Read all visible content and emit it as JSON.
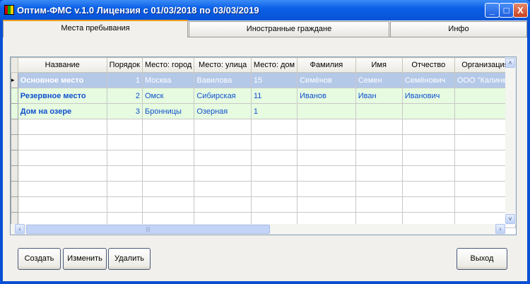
{
  "window": {
    "title": "Оптим-ФМС v.1.0  Лицензия с 01/03/2018 по 03/03/2019",
    "minimize": "_",
    "maximize": "□",
    "close": "X"
  },
  "tabs": [
    {
      "label": "Места пребывания"
    },
    {
      "label": "Иностранные граждане"
    },
    {
      "label": "Инфо"
    }
  ],
  "grid": {
    "columns": [
      "Название",
      "Порядок",
      "Место: город",
      "Место: улица",
      "Место: дом",
      "Фамилия",
      "Имя",
      "Отчество",
      "Организация"
    ],
    "rows": [
      [
        "Основное место",
        "1",
        "Москва",
        "Вавилова",
        "15",
        "Семёнов",
        "Семен",
        "Семёнович",
        "ООО \"Калинка\""
      ],
      [
        "Резервное место",
        "2",
        "Омск",
        "Сибирская",
        "11",
        "Иванов",
        "Иван",
        "Иванович",
        ""
      ],
      [
        "Дом на озере",
        "3",
        "Бронницы",
        "Озерная",
        "1",
        "",
        "",
        "",
        ""
      ]
    ],
    "selected_row_marker": "▸",
    "empty_rows": 7
  },
  "buttons": {
    "create": "Создать",
    "edit": "Изменить",
    "delete": "Удалить",
    "exit": "Выход"
  },
  "scroll": {
    "up": "˄",
    "down": "˅",
    "left": "‹",
    "right": "›",
    "grip": "|||"
  }
}
